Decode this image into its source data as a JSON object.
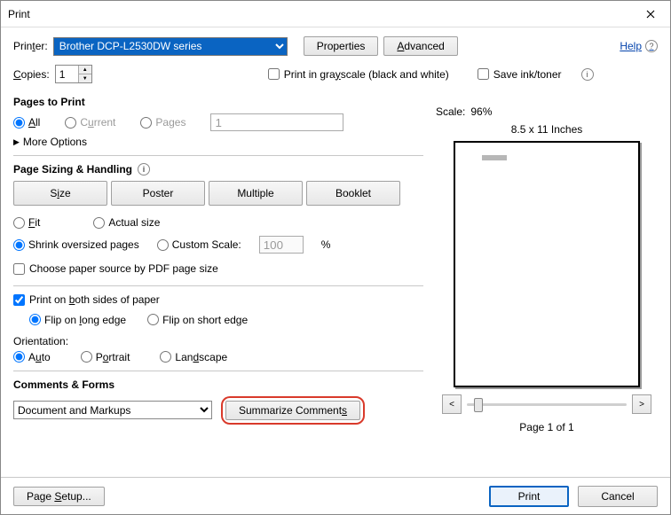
{
  "window": {
    "title": "Print"
  },
  "help": {
    "label": "Help"
  },
  "printer": {
    "label": "Printer:",
    "selected": "Brother DCP-L2530DW series",
    "properties_btn": "Properties",
    "advanced_btn": "Advanced"
  },
  "copies": {
    "label": "Copies:",
    "value": "1"
  },
  "options": {
    "grayscale": "Print in grayscale (black and white)",
    "save_ink": "Save ink/toner"
  },
  "pages_to_print": {
    "title": "Pages to Print",
    "all": "All",
    "current": "Current",
    "pages": "Pages",
    "pages_value": "1",
    "more": "More Options"
  },
  "sizing": {
    "title": "Page Sizing & Handling",
    "size": "Size",
    "poster": "Poster",
    "multiple": "Multiple",
    "booklet": "Booklet",
    "fit": "Fit",
    "actual": "Actual size",
    "shrink": "Shrink oversized pages",
    "custom_scale": "Custom Scale:",
    "custom_scale_value": "100",
    "percent": "%",
    "choose_paper": "Choose paper source by PDF page size"
  },
  "duplex": {
    "both_sides": "Print on both sides of paper",
    "flip_long": "Flip on long edge",
    "flip_short": "Flip on short edge"
  },
  "orientation": {
    "label": "Orientation:",
    "auto": "Auto",
    "portrait": "Portrait",
    "landscape": "Landscape"
  },
  "comments": {
    "title": "Comments & Forms",
    "selected": "Document and Markups",
    "summarize_btn": "Summarize Comments"
  },
  "preview": {
    "scale_label": "Scale:",
    "scale_value": "96%",
    "paper_size": "8.5 x 11 Inches",
    "page_of": "Page 1 of 1"
  },
  "footer": {
    "page_setup": "Page Setup...",
    "print": "Print",
    "cancel": "Cancel"
  }
}
